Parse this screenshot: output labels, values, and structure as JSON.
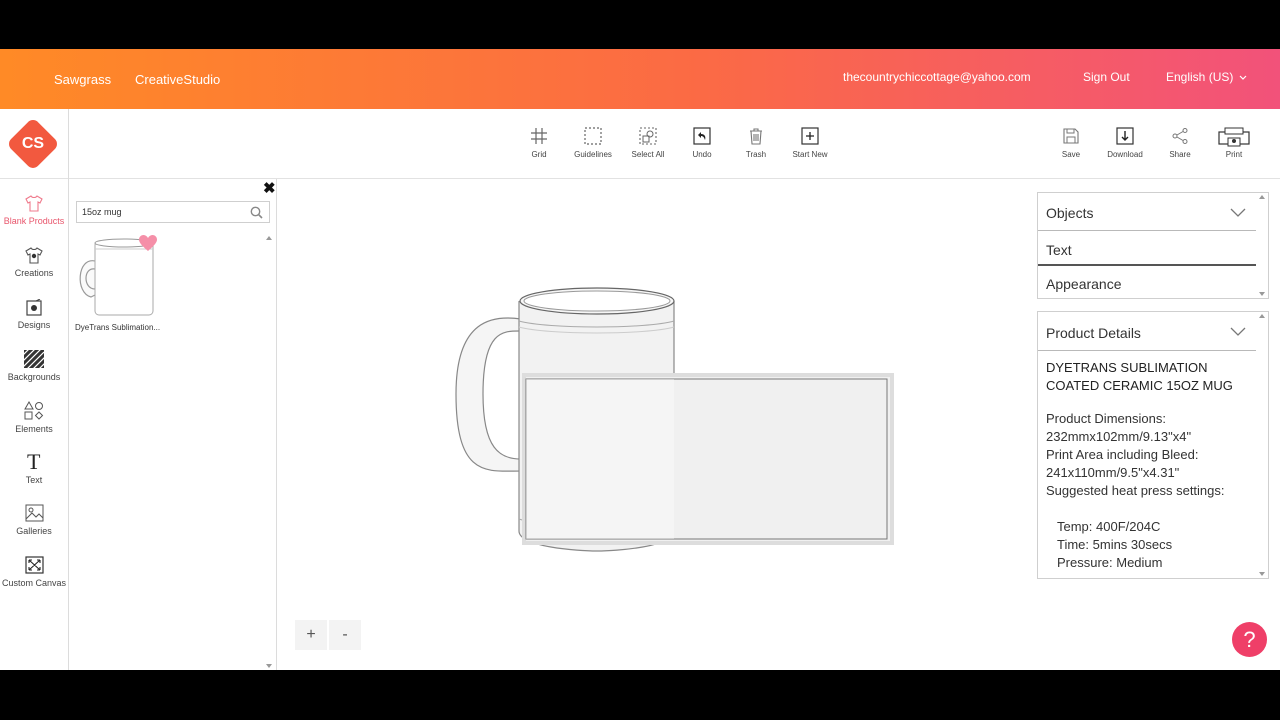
{
  "header": {
    "brand": "Sawgrass",
    "app": "CreativeStudio",
    "email": "thecountrychiccottage@yahoo.com",
    "signout": "Sign Out",
    "language": "English (US)"
  },
  "logo": {
    "text": "CS",
    "color": "#f2593f"
  },
  "toolbar": {
    "left": [
      {
        "label": "Grid",
        "icon": "grid-icon"
      },
      {
        "label": "Guidelines",
        "icon": "guidelines-icon"
      },
      {
        "label": "Select All",
        "icon": "select-all-icon"
      },
      {
        "label": "Undo",
        "icon": "undo-icon"
      },
      {
        "label": "Trash",
        "icon": "trash-icon"
      },
      {
        "label": "Start New",
        "icon": "start-new-icon"
      }
    ],
    "right": [
      {
        "label": "Save",
        "icon": "save-icon"
      },
      {
        "label": "Download",
        "icon": "download-icon"
      },
      {
        "label": "Share",
        "icon": "share-icon"
      },
      {
        "label": "Print",
        "icon": "print-icon"
      }
    ]
  },
  "sidebar": {
    "items": [
      {
        "label": "Blank Products",
        "icon": "tshirt-icon",
        "active": true
      },
      {
        "label": "Creations",
        "icon": "creations-icon"
      },
      {
        "label": "Designs",
        "icon": "designs-icon"
      },
      {
        "label": "Backgrounds",
        "icon": "backgrounds-icon"
      },
      {
        "label": "Elements",
        "icon": "elements-icon"
      },
      {
        "label": "Text",
        "icon": "text-icon"
      },
      {
        "label": "Galleries",
        "icon": "galleries-icon"
      },
      {
        "label": "Custom Canvas",
        "icon": "custom-canvas-icon"
      }
    ]
  },
  "search": {
    "value": "15oz mug"
  },
  "products": [
    {
      "caption": "DyeTrans Sublimation..."
    }
  ],
  "canvas": {
    "zoom_in": "+",
    "zoom_out": "-"
  },
  "right_panel": {
    "objects": "Objects",
    "text": "Text",
    "appearance": "Appearance"
  },
  "product_details": {
    "title": "Product Details",
    "name_line1": "DYETRANS SUBLIMATION",
    "name_line2": "COATED CERAMIC 15OZ MUG",
    "dims_label": "Product Dimensions:",
    "dims_value": "232mmx102mm/9.13\"x4\"",
    "print_label": "Print Area including Bleed:",
    "print_value": "241x110mm/9.5\"x4.31\"",
    "heat_label": "Suggested heat press settings:",
    "temp": "Temp: 400F/204C",
    "time": "Time: 5mins 30secs",
    "pressure": "Pressure: Medium"
  },
  "help": {
    "label": "?"
  },
  "colors": {
    "accent": "#ef3f68",
    "header_start": "#ff8a26",
    "header_end": "#f2527a"
  }
}
